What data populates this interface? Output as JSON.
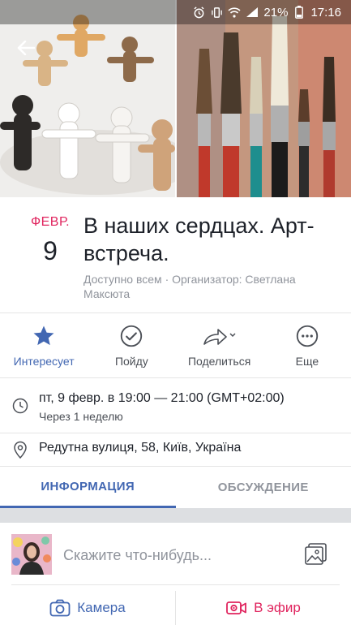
{
  "status_bar": {
    "battery_percent": "21%",
    "time": "17:16",
    "icons": [
      "alarm-icon",
      "vibrate-icon",
      "wifi-icon",
      "signal-icon",
      "battery-icon"
    ]
  },
  "cover": {
    "back_icon": "back-arrow-icon",
    "left_image": "paper-people-chain",
    "right_image": "paint-brushes"
  },
  "event": {
    "month": "ФЕВР.",
    "day": "9",
    "title": "В наших сердцах. Арт-встреча.",
    "meta": "Доступно всем · Организатор: Светлана Максюта"
  },
  "actions": [
    {
      "label": "Интересует",
      "icon": "star-icon",
      "active": true
    },
    {
      "label": "Пойду",
      "icon": "check-circle-icon",
      "active": false
    },
    {
      "label": "Поделиться",
      "icon": "share-icon",
      "active": false
    },
    {
      "label": "Еще",
      "icon": "more-icon",
      "active": false
    }
  ],
  "details": {
    "time_main": "пт, 9 февр. в 19:00 — 21:00 (GMT+02:00)",
    "time_sub": "Через 1 неделю",
    "place": "Редутна вулиця, 58, Київ, Україна"
  },
  "tabs": [
    {
      "label": "ИНФОРМАЦИЯ",
      "active": true
    },
    {
      "label": "ОБСУЖДЕНИЕ",
      "active": false
    }
  ],
  "composer": {
    "placeholder": "Скажите что-нибудь..."
  },
  "bottom": {
    "camera_label": "Камера",
    "live_label": "В эфир"
  },
  "colors": {
    "accent": "#4267b2",
    "red": "#e0245e",
    "muted": "#90949c"
  }
}
